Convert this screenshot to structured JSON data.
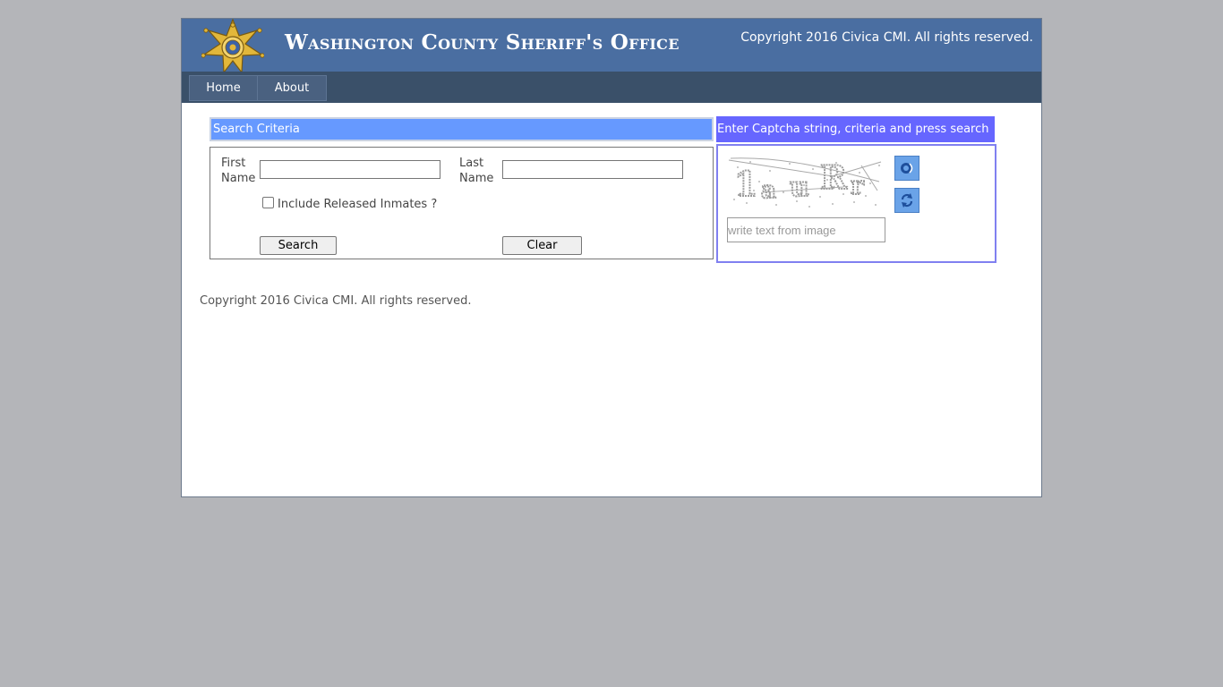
{
  "header": {
    "title": "Washington County Sheriff's Office",
    "copyright": "Copyright 2016 Civica CMI. All rights reserved."
  },
  "nav": {
    "items": [
      {
        "label": "Home"
      },
      {
        "label": "About"
      }
    ]
  },
  "search": {
    "header": "Search Criteria",
    "first_name_label": "First Name",
    "last_name_label": "Last Name",
    "first_name_value": "",
    "last_name_value": "",
    "include_released_label": "Include Released Inmates ?",
    "include_released_checked": false,
    "search_button": "Search",
    "clear_button": "Clear"
  },
  "captcha": {
    "header": "Enter Captcha string, criteria and press search",
    "image_text": "1auRr",
    "input_placeholder": "write text from image",
    "input_value": ""
  },
  "footer": {
    "copyright": "Copyright 2016 Civica CMI. All rights reserved."
  },
  "colors": {
    "header_bg": "#4a6ea1",
    "nav_bg": "#3a5069",
    "search_header_bg": "#6699ff",
    "captcha_header_bg": "#6666ff",
    "page_bg": "#b4b5b9"
  }
}
